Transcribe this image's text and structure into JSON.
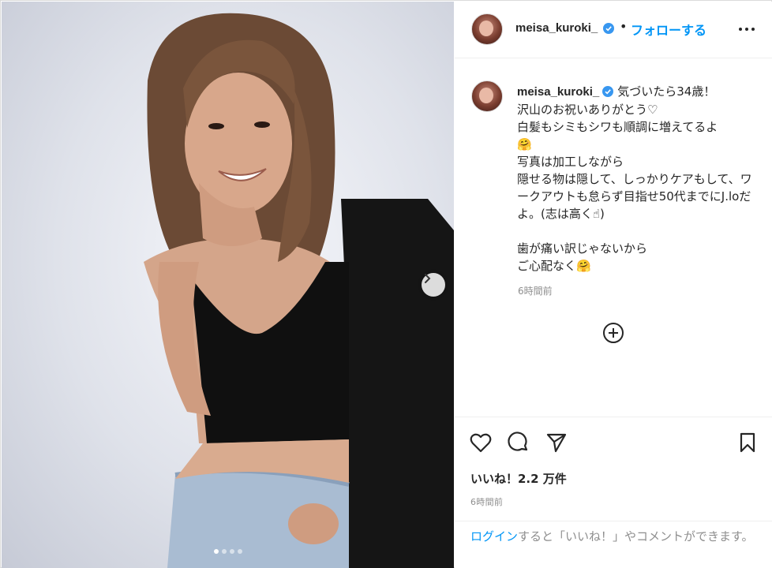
{
  "post": {
    "username": "meisa_kuroki_",
    "verified": true,
    "separator": "•",
    "follow_label": "フォローする",
    "caption": "気づいたら34歳！\n沢山のお祝いありがとう♡\n白髪もシミもシワも順調に増えてるよ\n🤗\n写真は加工しながら\n隠せる物は隠して、しっかりケアもして、ワークアウトも怠らず目指せ50代までにJ.loだよ。(志は高く☝︎)\n\n歯が痛い訳じゃないから\nご心配なく🤗",
    "caption_time": "6時間前",
    "likes": "いいね！2.2 万件",
    "post_time": "6時間前",
    "login_link": "ログイン",
    "login_rest": "すると「いいね！」やコメントができます。"
  },
  "carousel": {
    "current": 1,
    "total": 4
  },
  "icons": {
    "header_more": "more-horizontal-icon",
    "verified": "verified-badge-icon",
    "next": "chevron-right-icon",
    "load_more": "plus-circle-icon",
    "like": "heart-icon",
    "comment": "comment-icon",
    "share": "paper-plane-icon",
    "save": "bookmark-icon"
  },
  "colors": {
    "accent": "#0095f6",
    "text": "#262626",
    "muted": "#8e8e8e",
    "border": "#dbdbdb"
  }
}
